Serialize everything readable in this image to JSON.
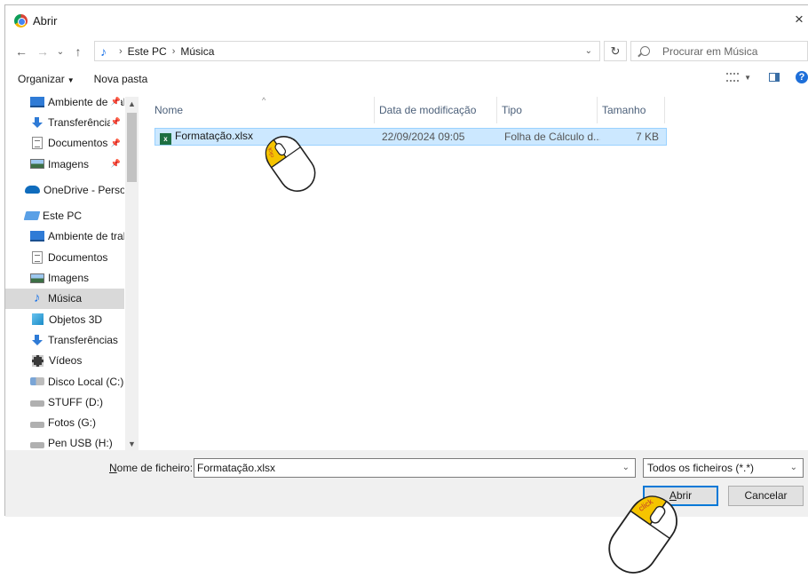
{
  "window": {
    "title": "Abrir",
    "close_glyph": "×"
  },
  "nav": {
    "back": "←",
    "forward": "→",
    "recent": "⌄",
    "up": "↑",
    "breadcrumb": [
      "Este PC",
      "Música"
    ],
    "refresh": "↻",
    "search_placeholder": "Procurar em Música"
  },
  "toolbar": {
    "organize": "Organizar",
    "new_folder": "Nova pasta"
  },
  "sidebar": {
    "items": [
      {
        "label": "Ambiente de trabalho",
        "icon": "desktop-icon",
        "pinned": true
      },
      {
        "label": "Transferências",
        "icon": "download-icon",
        "pinned": true
      },
      {
        "label": "Documentos",
        "icon": "documents-icon",
        "pinned": true
      },
      {
        "label": "Imagens",
        "icon": "pictures-icon",
        "pinned": true
      },
      {
        "label": "OneDrive - Personal",
        "icon": "onedrive-icon",
        "pinned": false
      },
      {
        "label": "Este PC",
        "icon": "this-pc-icon",
        "pinned": false
      },
      {
        "label": "Ambiente de trabalho",
        "icon": "desktop-icon",
        "pinned": false
      },
      {
        "label": "Documentos",
        "icon": "documents-icon",
        "pinned": false
      },
      {
        "label": "Imagens",
        "icon": "pictures-icon",
        "pinned": false
      },
      {
        "label": "Música",
        "icon": "music-icon",
        "pinned": false,
        "selected": true
      },
      {
        "label": "Objetos 3D",
        "icon": "3d-objects-icon",
        "pinned": false
      },
      {
        "label": "Transferências",
        "icon": "download-icon",
        "pinned": false
      },
      {
        "label": "Vídeos",
        "icon": "videos-icon",
        "pinned": false
      },
      {
        "label": "Disco Local (C:)",
        "icon": "local-disk-icon",
        "pinned": false
      },
      {
        "label": "STUFF (D:)",
        "icon": "drive-icon",
        "pinned": false
      },
      {
        "label": "Fotos (G:)",
        "icon": "drive-icon",
        "pinned": false
      },
      {
        "label": "Pen USB (H:)",
        "icon": "drive-icon",
        "pinned": false
      }
    ]
  },
  "columns": [
    "Nome",
    "Data de modificação",
    "Tipo",
    "Tamanho"
  ],
  "files": [
    {
      "name": "Formatação.xlsx",
      "modified": "22/09/2024 09:05",
      "type": "Folha de Cálculo d...",
      "size": "7 KB",
      "selected": true
    }
  ],
  "bottom": {
    "filename_label_accel": "N",
    "filename_label_rest": "ome de ficheiro:",
    "filename_value": "Formatação.xlsx",
    "filetype_value": "Todos os ficheiros (*.*)",
    "open_accel": "A",
    "open_rest": "brir",
    "cancel": "Cancelar"
  },
  "annotations": {
    "click_label": "click",
    "accent": "#f5c400"
  }
}
